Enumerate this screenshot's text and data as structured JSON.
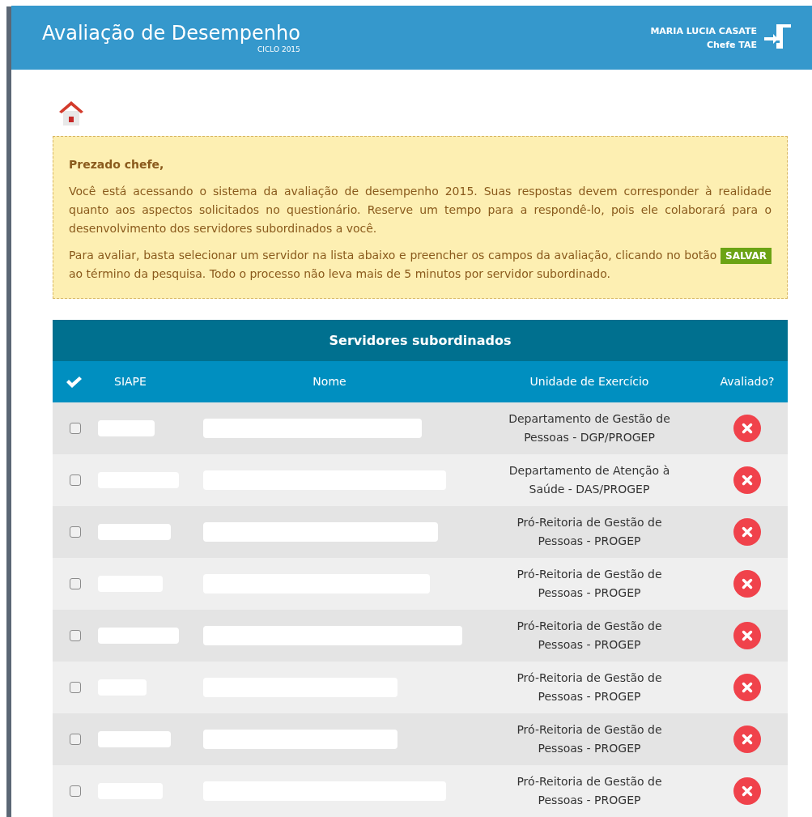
{
  "header": {
    "title": "Avaliação de Desempenho",
    "subtitle": "CICLO 2015",
    "user_name": "MARIA LUCIA CASATE",
    "user_role": "Chefe TAE"
  },
  "notice": {
    "greeting": "Prezado chefe,",
    "paragraphs": [
      "Você está acessando o sistema da avaliação de desempenho 2015. Suas respostas devem corresponder à realidade quanto aos aspectos solicitados no questionário. Reserve um tempo para a respondê-lo, pois ele colaborará para o desenvolvimento dos servidores subordinados a você."
    ],
    "before_button": "Para avaliar, basta selecionar um servidor na lista abaixo e preencher os campos da avaliação, clicando no botão",
    "button": "SALVAR",
    "after_button": "ao término da pesquisa. Todo o processo não leva mais de 5 minutos por servidor subordinado."
  },
  "table": {
    "title": "Servidores subordinados",
    "columns": [
      "SIAPE",
      "Nome",
      "Unidade de Exercício",
      "Avaliado?"
    ],
    "rows": [
      {
        "checked": false,
        "unit": "Departamento de Gestão de Pessoas - DGP/PROGEP",
        "evaluated": false
      },
      {
        "checked": false,
        "unit": "Departamento de Atenção à Saúde - DAS/PROGEP",
        "evaluated": false
      },
      {
        "checked": false,
        "unit": "Pró-Reitoria de Gestão de Pessoas - PROGEP",
        "evaluated": false
      },
      {
        "checked": false,
        "unit": "Pró-Reitoria de Gestão de Pessoas - PROGEP",
        "evaluated": false
      },
      {
        "checked": false,
        "unit": "Pró-Reitoria de Gestão de Pessoas - PROGEP",
        "evaluated": false
      },
      {
        "checked": false,
        "unit": "Pró-Reitoria de Gestão de Pessoas - PROGEP",
        "evaluated": false
      },
      {
        "checked": false,
        "unit": "Pró-Reitoria de Gestão de Pessoas - PROGEP",
        "evaluated": false
      },
      {
        "checked": false,
        "unit": "Pró-Reitoria de Gestão de Pessoas - PROGEP",
        "evaluated": false
      }
    ]
  }
}
